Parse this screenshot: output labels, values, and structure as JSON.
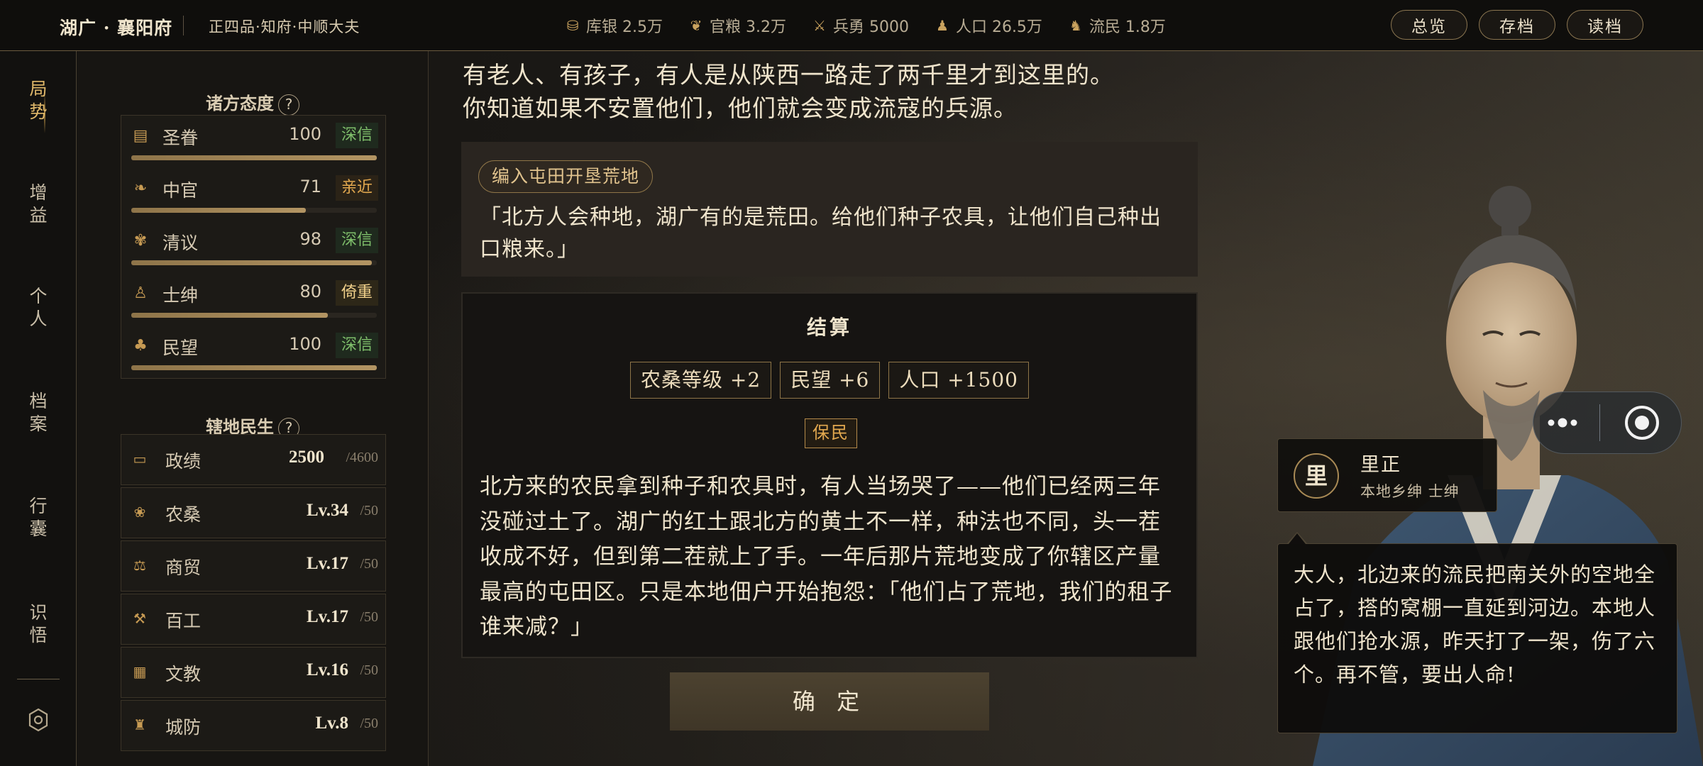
{
  "header": {
    "region": "湖广 · 襄阳府",
    "rank": "正四品·知府·中顺大夫",
    "resources": [
      {
        "icon": "silver-icon",
        "label": "库银 2.5万"
      },
      {
        "icon": "grain-icon",
        "label": "官粮 3.2万"
      },
      {
        "icon": "soldier-icon",
        "label": "兵勇 5000"
      },
      {
        "icon": "population-icon",
        "label": "人口 26.5万"
      },
      {
        "icon": "refugee-icon",
        "label": "流民 1.8万"
      }
    ],
    "actions": {
      "overview": "总览",
      "save": "存档",
      "load": "读档"
    }
  },
  "nav": {
    "items": [
      "局势",
      "增益",
      "个人",
      "档案",
      "行囊",
      "识悟"
    ],
    "active": "局势",
    "settings_icon": "settings-icon"
  },
  "attitudes": {
    "title": "诸方态度",
    "help": "?",
    "rows": [
      {
        "icon": "edict-icon",
        "name": "圣眷",
        "value": "100",
        "tag": "深信",
        "tag_style": "deep",
        "level": 1.0
      },
      {
        "icon": "eunuch-icon",
        "name": "中官",
        "value": "71",
        "tag": "亲近",
        "tag_style": "close",
        "level": 0.71
      },
      {
        "icon": "scholar-icon",
        "name": "清议",
        "value": "98",
        "tag": "深信",
        "tag_style": "deep",
        "level": 0.98
      },
      {
        "icon": "gentry-icon",
        "name": "士绅",
        "value": "80",
        "tag": "倚重",
        "tag_style": "rely",
        "level": 0.8
      },
      {
        "icon": "people-icon",
        "name": "民望",
        "value": "100",
        "tag": "深信",
        "tag_style": "deep",
        "level": 1.0
      }
    ]
  },
  "development": {
    "title": "辖地民生",
    "help": "?",
    "rows": [
      {
        "icon": "governance-icon",
        "name": "政绩",
        "current": "2500",
        "max": "/4600"
      },
      {
        "icon": "agriculture-icon",
        "name": "农桑",
        "current": "Lv.34",
        "max": "/50"
      },
      {
        "icon": "trade-icon",
        "name": "商贸",
        "current": "Lv.17",
        "max": "/50"
      },
      {
        "icon": "craft-icon",
        "name": "百工",
        "current": "Lv.17",
        "max": "/50"
      },
      {
        "icon": "education-icon",
        "name": "文教",
        "current": "Lv.16",
        "max": "/50"
      },
      {
        "icon": "defense-icon",
        "name": "城防",
        "current": "Lv.8",
        "max": "/50"
      }
    ]
  },
  "story": {
    "narration_line1": "有老人、有孩子，有人是从陕西一路走了两千里才到这里的。",
    "narration_line2": "你知道如果不安置他们，他们就会变成流寇的兵源。",
    "choice_tag": "编入屯田开垦荒地",
    "choice_quote": "「北方人会种地，湖广有的是荒田。给他们种子农具，让他们自己种出口粮来。」"
  },
  "settlement": {
    "title": "结算",
    "effects": [
      "农桑等级 +2",
      "民望 +6",
      "人口 +1500"
    ],
    "badge": "保民",
    "text": "北方来的农民拿到种子和农具时，有人当场哭了——他们已经两三年没碰过土了。湖广的红土跟北方的黄土不一样，种法也不同，头一茬收成不好，但到第二茬就上了手。一年后那片荒地变成了你辖区产量最高的屯田区。只是本地佃户开始抱怨：「他们占了荒地，我们的租子谁来减？」",
    "confirm": "确 定"
  },
  "npc": {
    "avatar_char": "里",
    "name": "里正",
    "title": "本地乡绅  士绅",
    "dialog": "大人，北边来的流民把南关外的空地全占了，搭的窝棚一直延到河边。本地人跟他们抢水源，昨天打了一架，伤了六个。再不管，要出人命!"
  },
  "colors": {
    "accent": "#c9a25e",
    "deep": "#7fbf6b",
    "close": "#e2a84f",
    "border": "#8e7548"
  }
}
